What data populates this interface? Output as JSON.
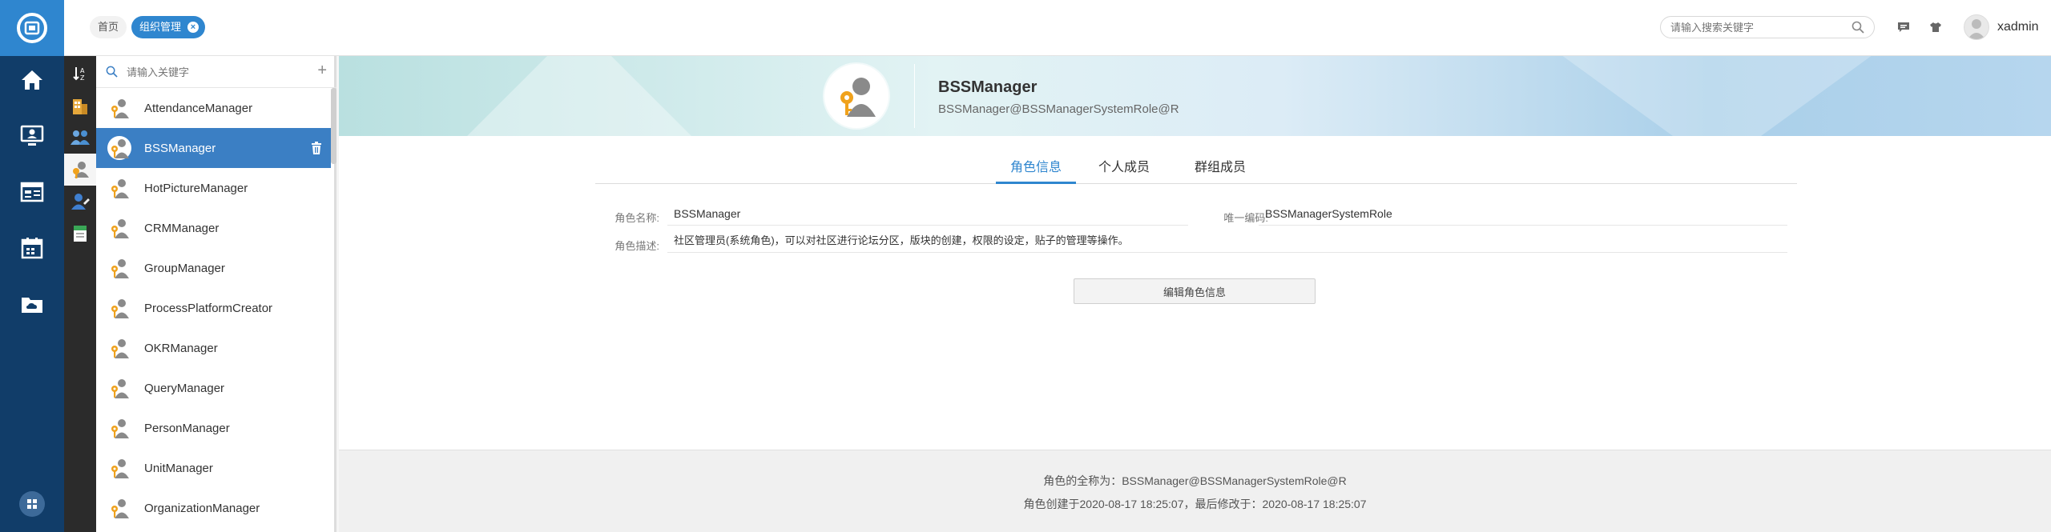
{
  "header": {
    "breadcrumbs": [
      {
        "label": "首页"
      },
      {
        "label": "组织管理"
      }
    ],
    "search_placeholder": "请输入搜索关键字",
    "username": "xadmin"
  },
  "list": {
    "search_placeholder": "请输入关键字",
    "add_label": "+",
    "items": [
      {
        "label": "AttendanceManager"
      },
      {
        "label": "BSSManager"
      },
      {
        "label": "HotPictureManager"
      },
      {
        "label": "CRMManager"
      },
      {
        "label": "GroupManager"
      },
      {
        "label": "ProcessPlatformCreator"
      },
      {
        "label": "OKRManager"
      },
      {
        "label": "QueryManager"
      },
      {
        "label": "PersonManager"
      },
      {
        "label": "UnitManager"
      },
      {
        "label": "OrganizationManager"
      }
    ],
    "selected_index": 1
  },
  "role": {
    "name": "BSSManager",
    "distinguished_name": "BSSManager@BSSManagerSystemRole@R"
  },
  "tabs": [
    {
      "label": "角色信息"
    },
    {
      "label": "个人成员"
    },
    {
      "label": "群组成员"
    }
  ],
  "form": {
    "name_label": "角色名称:",
    "name_value": "BSSManager",
    "code_label": "唯一编码:",
    "code_value": "BSSManagerSystemRole",
    "desc_label": "角色描述:",
    "desc_value": "社区管理员(系统角色)，可以对社区进行论坛分区，版块的创建，权限的设定，贴子的管理等操作。",
    "edit_button": "编辑角色信息"
  },
  "footer": {
    "full_name": "角色的全称为：BSSManager@BSSManagerSystemRole@R",
    "timestamps": "角色创建于2020-08-17 18:25:07，最后修改于：2020-08-17 18:25:07"
  },
  "colors": {
    "rail": "#113d69",
    "accent": "#2f86cf",
    "selected_item": "#3b7fc4"
  }
}
